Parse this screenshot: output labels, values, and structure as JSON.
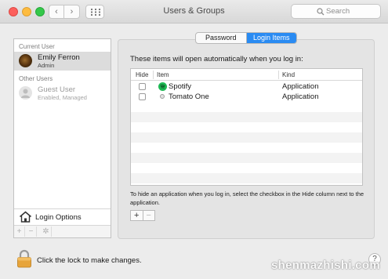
{
  "window": {
    "title": "Users & Groups",
    "back_icon": "‹",
    "forward_icon": "›",
    "search_placeholder": "Search"
  },
  "sidebar": {
    "current_user_label": "Current User",
    "current_user": {
      "name": "Emily Ferron",
      "role": "Admin"
    },
    "other_users_label": "Other Users",
    "other_users": [
      {
        "name": "Guest User",
        "role": "Enabled, Managed"
      }
    ],
    "login_options_label": "Login Options",
    "toolbar": {
      "add": "+",
      "remove": "−",
      "action": "✲"
    }
  },
  "tabs": {
    "password": "Password",
    "login_items": "Login Items",
    "selected": "Login Items"
  },
  "login_items": {
    "intro": "These items will open automatically when you log in:",
    "columns": {
      "hide": "Hide",
      "item": "Item",
      "kind": "Kind"
    },
    "rows": [
      {
        "name": "Spotify",
        "kind": "Application",
        "hidden": false,
        "icon": "spotify-icon"
      },
      {
        "name": "Tomato One",
        "kind": "Application",
        "hidden": false,
        "icon": "tomato-one-icon"
      }
    ],
    "help_text": "To hide an application when you log in, select the checkbox in the Hide column next to the application.",
    "add": "+",
    "remove": "−"
  },
  "footer": {
    "lock_text": "Click the lock to make changes.",
    "help": "?"
  },
  "watermark": "shenmazhishi.com",
  "colors": {
    "selected_tab": "#2a8bf2",
    "spotify": "#1db954",
    "lock": "#e7a43a"
  }
}
